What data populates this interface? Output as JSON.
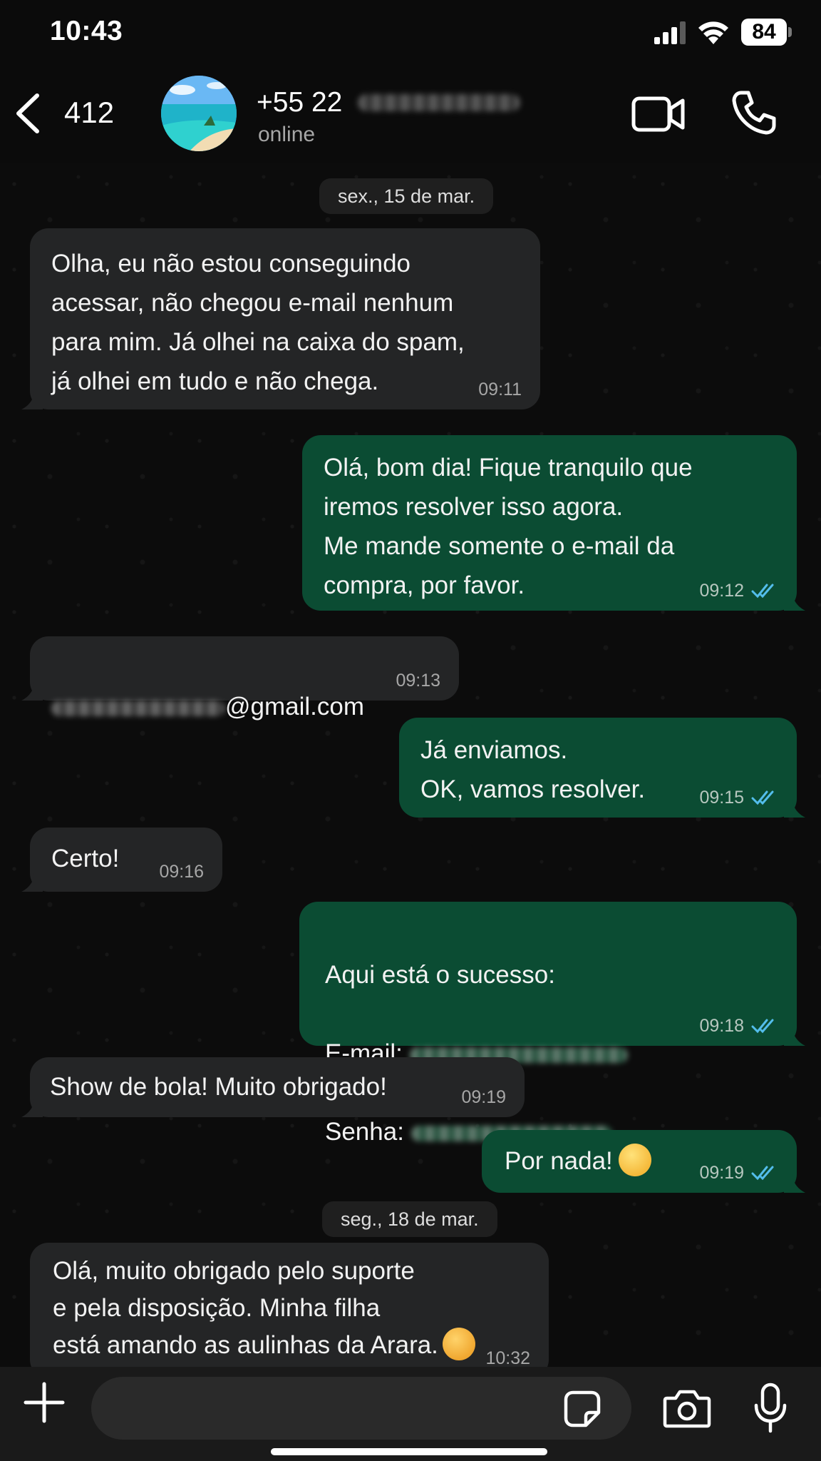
{
  "status_bar": {
    "time": "10:43",
    "battery": "84"
  },
  "header": {
    "back_count": "412",
    "contact_name": "+55 22",
    "contact_status": "online"
  },
  "chat": {
    "dates": [
      "sex., 15 de mar.",
      "seg., 18 de mar."
    ],
    "messages": [
      {
        "direction": "in",
        "text": "Olha, eu não estou conseguindo\nacessar, não chegou e-mail nenhum\npara mim. Já olhei na caixa do spam,\njá olhei em tudo e não chega.",
        "time": "09:11"
      },
      {
        "direction": "out",
        "text": "Olá, bom dia! Fique tranquilo que\niremos resolver isso agora.\nMe mande somente o e-mail da\ncompra, por favor.",
        "time": "09:12",
        "status": "read"
      },
      {
        "direction": "in",
        "text": "@gmail.com",
        "time": "09:13"
      },
      {
        "direction": "out",
        "text": "Já enviamos.\nOK, vamos resolver.",
        "time": "09:15",
        "status": "read"
      },
      {
        "direction": "in",
        "text": "Certo!",
        "time": "09:16"
      },
      {
        "direction": "out",
        "line1": "Aqui está o sucesso:",
        "line2": "E-mail:",
        "line3": "Senha:",
        "time": "09:18",
        "status": "read"
      },
      {
        "direction": "in",
        "text": "Show de bola! Muito obrigado!",
        "time": "09:19"
      },
      {
        "direction": "out",
        "text": "Por nada!",
        "time": "09:19",
        "status": "read"
      },
      {
        "direction": "in",
        "text": "Olá, muito obrigado pelo suporte\ne pela disposição. Minha filha\nestá amando as aulinhas da Arara.",
        "time": "10:32"
      }
    ]
  },
  "icons": {
    "back": "chevron-left-icon",
    "video": "video-camera-icon",
    "call": "phone-icon",
    "plus": "plus-icon",
    "sticker": "sticker-icon",
    "camera": "camera-icon",
    "mic": "microphone-icon",
    "read_tick": "double-check-icon"
  },
  "colors": {
    "incoming_bubble": "#242526",
    "outgoing_bubble": "#0b4c33",
    "read_tick": "#53bdeb",
    "background": "#0b0b0b"
  }
}
